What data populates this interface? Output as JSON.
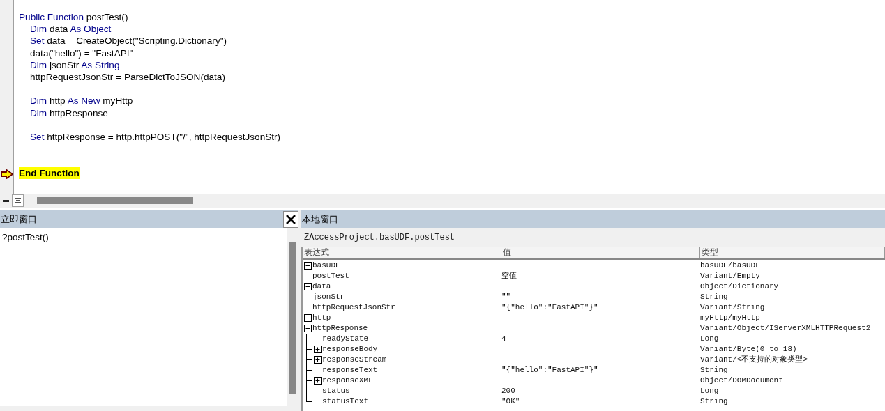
{
  "code": {
    "blocks": [
      {
        "lines": [
          {
            "indent": false,
            "segments": [
              {
                "kind": "keyword",
                "text": "Public Function"
              },
              {
                "kind": "plain",
                "text": " postTest()"
              }
            ]
          },
          {
            "indent": true,
            "segments": [
              {
                "kind": "keyword",
                "text": "Dim"
              },
              {
                "kind": "plain",
                "text": " data "
              },
              {
                "kind": "keyword",
                "text": "As Object"
              }
            ]
          },
          {
            "indent": true,
            "segments": [
              {
                "kind": "keyword",
                "text": "Set"
              },
              {
                "kind": "plain",
                "text": " data = CreateObject(\"Scripting.Dictionary\")"
              }
            ]
          },
          {
            "indent": true,
            "segments": [
              {
                "kind": "plain",
                "text": "data(\"hello\") = \"FastAPI\""
              }
            ]
          },
          {
            "indent": true,
            "segments": [
              {
                "kind": "keyword",
                "text": "Dim"
              },
              {
                "kind": "plain",
                "text": " jsonStr "
              },
              {
                "kind": "keyword",
                "text": "As String"
              }
            ]
          },
          {
            "indent": true,
            "segments": [
              {
                "kind": "plain",
                "text": "httpRequestJsonStr = ParseDictToJSON(data)"
              }
            ]
          }
        ]
      },
      {
        "lines": [
          {
            "indent": true,
            "segments": [
              {
                "kind": "keyword",
                "text": "Dim"
              },
              {
                "kind": "plain",
                "text": " http "
              },
              {
                "kind": "keyword",
                "text": "As New"
              },
              {
                "kind": "plain",
                "text": " myHttp"
              }
            ]
          },
          {
            "indent": true,
            "segments": [
              {
                "kind": "keyword",
                "text": "Dim"
              },
              {
                "kind": "plain",
                "text": " httpResponse"
              }
            ]
          }
        ]
      },
      {
        "lines": [
          {
            "indent": true,
            "segments": [
              {
                "kind": "keyword",
                "text": "Set"
              },
              {
                "kind": "plain",
                "text": " httpResponse = http.httpPOST(\"/\", httpRequestJsonStr)"
              }
            ]
          }
        ]
      }
    ],
    "current_line": {
      "text": "End Function",
      "highlighted": true
    }
  },
  "view_buttons": [
    {
      "kind": "procedure",
      "selected": false
    },
    {
      "kind": "module",
      "selected": true
    }
  ],
  "immediate": {
    "title": "立即窗口",
    "lines": [
      "?postTest()"
    ]
  },
  "locals": {
    "title": "本地窗口",
    "context": "ZAccessProject.basUDF.postTest",
    "columns": [
      "表达式",
      "值",
      "类型"
    ],
    "rows": [
      {
        "expression": "basUDF",
        "expanded": false,
        "type": "basUDF/basUDF"
      },
      {
        "expression": "postTest",
        "value": "空值",
        "type": "Variant/Empty"
      },
      {
        "expression": "data",
        "expanded": false,
        "type": "Object/Dictionary"
      },
      {
        "expression": "jsonStr",
        "value": "\"\"",
        "type": "String"
      },
      {
        "expression": "httpRequestJsonStr",
        "value": "\"{\"hello\":\"FastAPI\"}\"",
        "type": "Variant/String"
      },
      {
        "expression": "http",
        "expanded": false,
        "type": "myHttp/myHttp"
      },
      {
        "expression": "httpResponse",
        "expanded": true,
        "type": "Variant/Object/IServerXMLHTTPRequest2",
        "children": [
          {
            "expression": "readyState",
            "value": "4",
            "type": "Long"
          },
          {
            "expression": "responseBody",
            "expanded": false,
            "type": "Variant/Byte(0 to 18)"
          },
          {
            "expression": "responseStream",
            "expanded": false,
            "type": "Variant/<不支持的对象类型>"
          },
          {
            "expression": "responseText",
            "value": "\"{\"hello\":\"FastAPI\"}\"",
            "type": "String"
          },
          {
            "expression": "responseXML",
            "expanded": false,
            "type": "Object/DOMDocument"
          },
          {
            "expression": "status",
            "value": "200",
            "type": "Long"
          },
          {
            "expression": "statusText",
            "value": "\"OK\"",
            "type": "String"
          }
        ]
      }
    ]
  }
}
